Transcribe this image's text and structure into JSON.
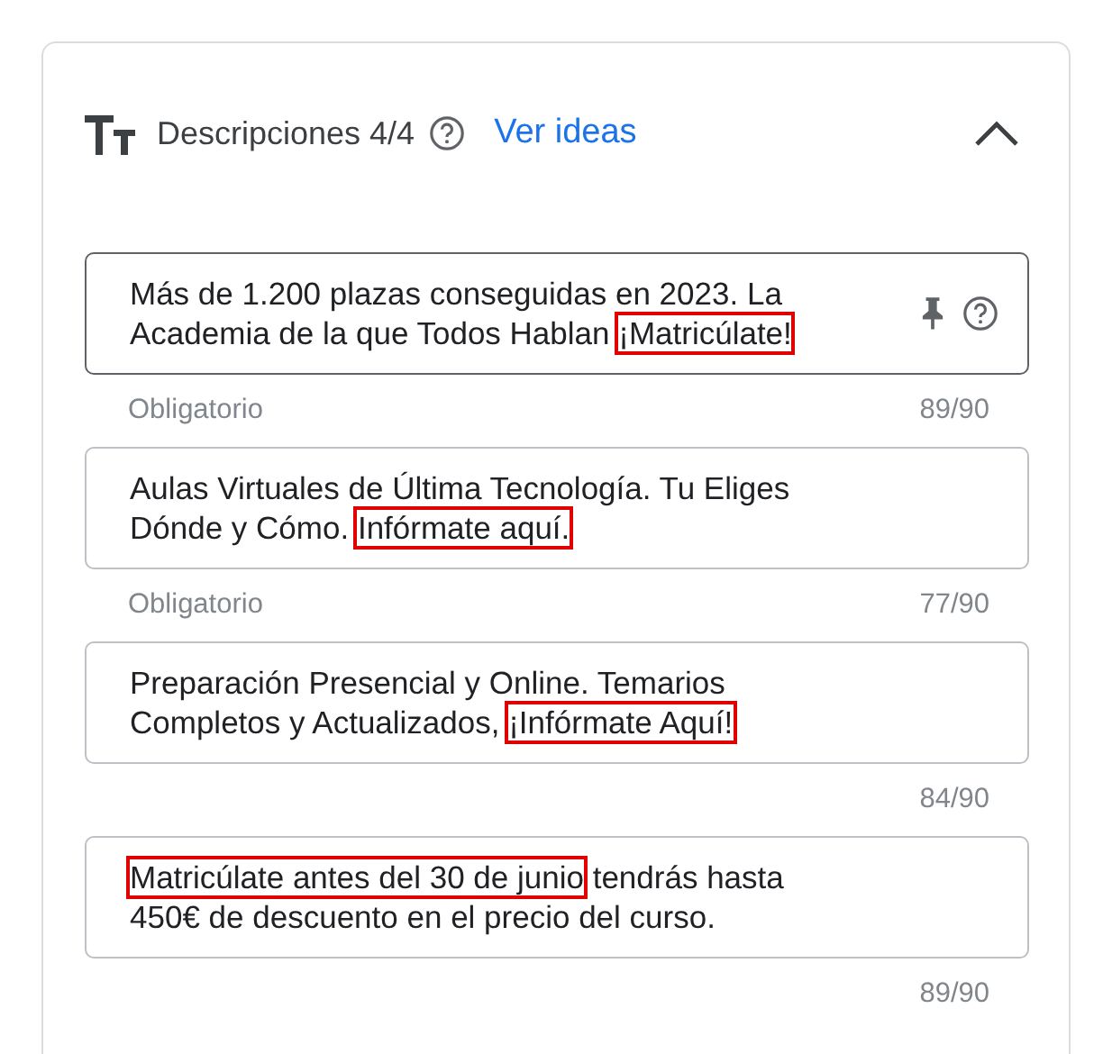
{
  "header": {
    "title": "Descripciones 4/4",
    "link": "Ver ideas",
    "expanded": true
  },
  "fields": [
    {
      "focused": true,
      "pinned": true,
      "lines": [
        [
          {
            "text": "Más de 1.200 plazas conseguidas en 2023. La",
            "highlighted": false
          }
        ],
        [
          {
            "text": "Academia de la que Todos Hablan ",
            "highlighted": false
          },
          {
            "text": "¡Matricúlate!",
            "highlighted": true
          }
        ]
      ],
      "helper": "Obligatorio",
      "counter": "89/90"
    },
    {
      "focused": false,
      "pinned": false,
      "lines": [
        [
          {
            "text": "Aulas Virtuales de Última Tecnología. Tu Eliges",
            "highlighted": false
          }
        ],
        [
          {
            "text": "Dónde y Cómo. ",
            "highlighted": false
          },
          {
            "text": "Infórmate aquí.",
            "highlighted": true
          }
        ]
      ],
      "helper": "Obligatorio",
      "counter": "77/90"
    },
    {
      "focused": false,
      "pinned": false,
      "lines": [
        [
          {
            "text": "Preparación Presencial y Online. Temarios",
            "highlighted": false
          }
        ],
        [
          {
            "text": "Completos y Actualizados, ",
            "highlighted": false
          },
          {
            "text": "¡Infórmate Aquí!",
            "highlighted": true
          }
        ]
      ],
      "counter": "84/90"
    },
    {
      "focused": false,
      "pinned": false,
      "lines": [
        [
          {
            "text": "Matricúlate antes del 30 de junio",
            "highlighted": true
          },
          {
            "text": " tendrás hasta",
            "highlighted": false
          }
        ],
        [
          {
            "text": "450€ de descuento en el precio del curso.",
            "highlighted": false
          }
        ]
      ],
      "counter": "89/90"
    }
  ]
}
